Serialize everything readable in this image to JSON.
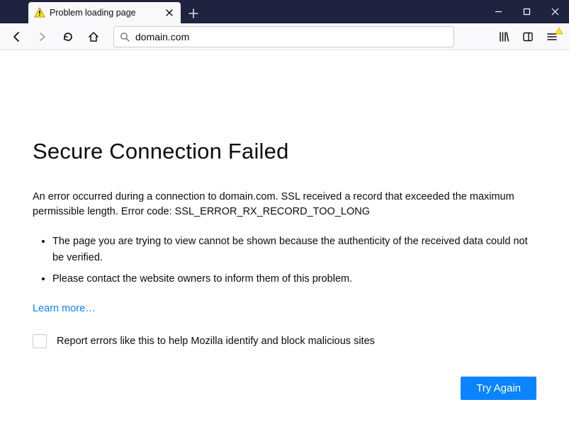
{
  "tab": {
    "title": "Problem loading page"
  },
  "urlbar": {
    "value": "domain.com"
  },
  "error": {
    "heading": "Secure Connection Failed",
    "desc": "An error occurred during a connection to domain.com. SSL received a record that exceeded the maximum permissible length. Error code: SSL_ERROR_RX_RECORD_TOO_LONG",
    "bullets": [
      "The page you are trying to view cannot be shown because the authenticity of the received data could not be verified.",
      "Please contact the website owners to inform them of this problem."
    ],
    "learn_more": "Learn more…",
    "report_label": "Report errors like this to help Mozilla identify and block malicious sites",
    "try_again": "Try Again"
  }
}
